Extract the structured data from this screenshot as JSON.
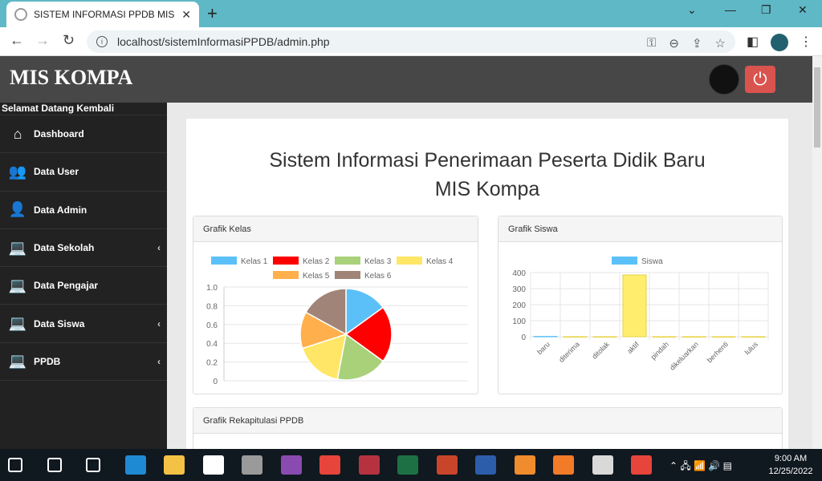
{
  "browser": {
    "tab_title": "SISTEM INFORMASI PPDB MIS KO",
    "url": "localhost/sistemInformasiPPDB/admin.php"
  },
  "app": {
    "brand": "MIS KOMPA",
    "welcome": "Selamat Datang Kembali"
  },
  "sidebar": {
    "items": [
      {
        "label": "Dashboard",
        "icon": "home-icon",
        "glyph": "⌂",
        "has_submenu": false
      },
      {
        "label": "Data User",
        "icon": "users-icon",
        "glyph": "👥",
        "has_submenu": false
      },
      {
        "label": "Data Admin",
        "icon": "user-icon",
        "glyph": "👤",
        "has_submenu": false
      },
      {
        "label": "Data Sekolah",
        "icon": "laptop-icon",
        "glyph": "💻",
        "has_submenu": true
      },
      {
        "label": "Data Pengajar",
        "icon": "laptop-icon",
        "glyph": "💻",
        "has_submenu": false
      },
      {
        "label": "Data Siswa",
        "icon": "laptop-icon",
        "glyph": "💻",
        "has_submenu": true
      },
      {
        "label": "PPDB",
        "icon": "laptop-icon",
        "glyph": "💻",
        "has_submenu": true
      }
    ]
  },
  "main": {
    "title_line1": "Sistem Informasi Penerimaan Peserta Didik Baru",
    "title_line2": "MIS Kompa",
    "cards": {
      "kelas": "Grafik Kelas",
      "siswa": "Grafik Siswa",
      "rekap": "Grafik Rekapitulasi PPDB"
    }
  },
  "chart_data": [
    {
      "type": "pie",
      "title": "Grafik Kelas",
      "categories": [
        "Kelas 1",
        "Kelas 2",
        "Kelas 3",
        "Kelas 4",
        "Kelas 5",
        "Kelas 6"
      ],
      "values": [
        15,
        20,
        18,
        17,
        13,
        17
      ],
      "colors": [
        "#5bc0f8",
        "#ff0000",
        "#a8d17a",
        "#ffe666",
        "#ffb04c",
        "#a08478"
      ],
      "yticks": [
        "1.0",
        "0.8",
        "0.6",
        "0.4",
        "0.2",
        "0"
      ],
      "grid": true,
      "legend": "top"
    },
    {
      "type": "bar",
      "title": "Grafik Siswa",
      "categories": [
        "baru",
        "diterima",
        "ditolak",
        "aktif",
        "pindah",
        "dikeluarkan",
        "berhenti",
        "lulus"
      ],
      "series": [
        {
          "name": "Siswa",
          "values": [
            2,
            0,
            0,
            385,
            0,
            0,
            0,
            0
          ]
        }
      ],
      "bar_color": "#ffee6e",
      "legend_color": "#5bc0f8",
      "ylim": [
        0,
        400
      ],
      "yticks": [
        400,
        300,
        200,
        100,
        0
      ],
      "grid": true,
      "legend": "top"
    }
  ],
  "taskbar": {
    "time": "9:00 AM",
    "date": "12/25/2022",
    "apps": [
      {
        "name": "start-icon",
        "color": "#ffffff"
      },
      {
        "name": "search-icon",
        "color": "#ffffff"
      },
      {
        "name": "task-view-icon",
        "color": "#ffffff"
      },
      {
        "name": "edge-icon",
        "color": "#1f8ad4"
      },
      {
        "name": "file-explorer-icon",
        "color": "#f3c244"
      },
      {
        "name": "store-icon",
        "color": "#ffffff"
      },
      {
        "name": "firewall-icon",
        "color": "#9a9a9a"
      },
      {
        "name": "winrar-icon",
        "color": "#8a4bb0"
      },
      {
        "name": "chrome-icon",
        "color": "#e7453b"
      },
      {
        "name": "access-icon",
        "color": "#b7323f"
      },
      {
        "name": "excel-icon",
        "color": "#1d7044"
      },
      {
        "name": "powerpoint-icon",
        "color": "#c9452a"
      },
      {
        "name": "word-icon",
        "color": "#2c5dab"
      },
      {
        "name": "sublime-icon",
        "color": "#f08c2e"
      },
      {
        "name": "xampp-icon",
        "color": "#f37b27"
      },
      {
        "name": "paint-icon",
        "color": "#d9d9d9"
      },
      {
        "name": "chrome-active-icon",
        "color": "#e7453b"
      }
    ]
  }
}
